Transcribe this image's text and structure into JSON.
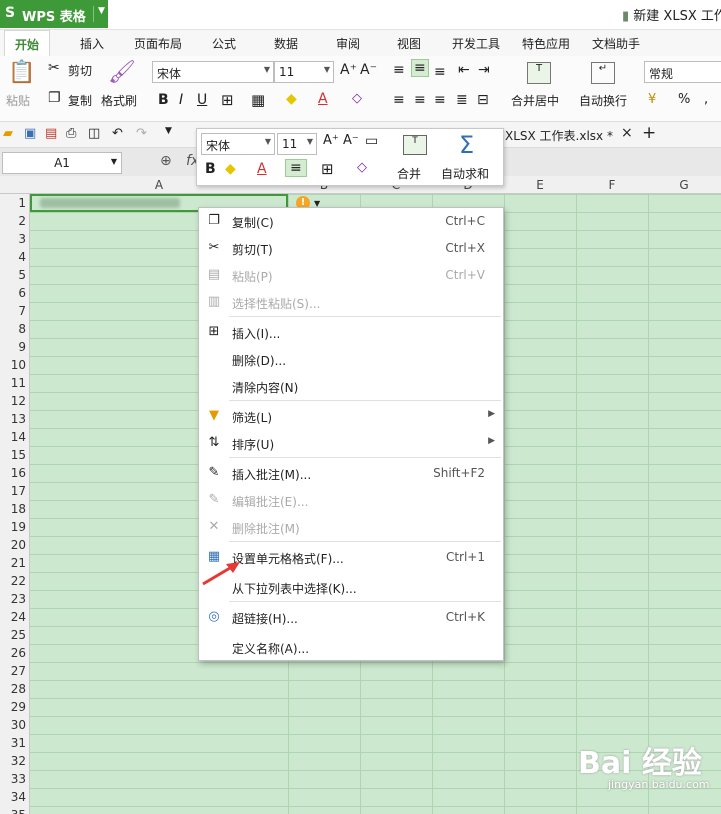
{
  "app": {
    "name": "WPS 表格",
    "logo": "S",
    "doc_title": "新建 XLSX 工作"
  },
  "tabs": [
    "开始",
    "插入",
    "页面布局",
    "公式",
    "数据",
    "审阅",
    "视图",
    "开发工具",
    "特色应用",
    "文档助手"
  ],
  "ribbon": {
    "paste": "粘贴",
    "cut": "剪切",
    "copy": "复制",
    "format_painter": "格式刷",
    "font_name": "宋体",
    "font_size": "11",
    "merge_center": "合并居中",
    "wrap_text": "自动换行",
    "number_format": "常规",
    "percent": "%"
  },
  "doc_tab": {
    "name": "XLSX 工作表.xlsx *",
    "close": "×",
    "new": "+"
  },
  "formula_bar": {
    "cell_ref": "A1",
    "fx": "fx"
  },
  "columns": [
    "A",
    "B",
    "C",
    "D",
    "E",
    "F",
    "G"
  ],
  "rows": [
    "1",
    "2",
    "3",
    "4",
    "5",
    "6",
    "7",
    "8",
    "9",
    "10",
    "11",
    "12",
    "13",
    "14",
    "15",
    "16",
    "17",
    "18",
    "19",
    "20",
    "21",
    "22",
    "23",
    "24",
    "25",
    "26",
    "27",
    "28",
    "29",
    "30",
    "31",
    "32",
    "33",
    "34",
    "35"
  ],
  "mini_toolbar": {
    "font_name": "宋体",
    "font_size": "11",
    "merge": "合并",
    "autosum": "自动求和"
  },
  "context_menu": [
    {
      "label": "复制(C)",
      "shortcut": "Ctrl+C",
      "icon": "copy-icon",
      "disabled": false
    },
    {
      "label": "剪切(T)",
      "shortcut": "Ctrl+X",
      "icon": "scissors-icon",
      "disabled": false
    },
    {
      "label": "粘贴(P)",
      "shortcut": "Ctrl+V",
      "icon": "paste-icon",
      "disabled": true
    },
    {
      "label": "选择性粘贴(S)...",
      "shortcut": "",
      "icon": "paste-special-icon",
      "disabled": true
    },
    {
      "label": "插入(I)...",
      "shortcut": "",
      "icon": "insert-icon",
      "disabled": false
    },
    {
      "label": "删除(D)...",
      "shortcut": "",
      "icon": "",
      "disabled": false
    },
    {
      "label": "清除内容(N)",
      "shortcut": "",
      "icon": "",
      "disabled": false
    },
    {
      "label": "筛选(L)",
      "shortcut": "",
      "icon": "filter-icon",
      "disabled": false,
      "submenu": true
    },
    {
      "label": "排序(U)",
      "shortcut": "",
      "icon": "sort-icon",
      "disabled": false,
      "submenu": true
    },
    {
      "label": "插入批注(M)...",
      "shortcut": "Shift+F2",
      "icon": "comment-add-icon",
      "disabled": false
    },
    {
      "label": "编辑批注(E)...",
      "shortcut": "",
      "icon": "comment-edit-icon",
      "disabled": true
    },
    {
      "label": "删除批注(M)",
      "shortcut": "",
      "icon": "comment-delete-icon",
      "disabled": true
    },
    {
      "label": "设置单元格格式(F)...",
      "shortcut": "Ctrl+1",
      "icon": "format-cells-icon",
      "disabled": false
    },
    {
      "label": "从下拉列表中选择(K)...",
      "shortcut": "",
      "icon": "",
      "disabled": false
    },
    {
      "label": "超链接(H)...",
      "shortcut": "Ctrl+K",
      "icon": "hyperlink-icon",
      "disabled": false
    },
    {
      "label": "定义名称(A)...",
      "shortcut": "",
      "icon": "",
      "disabled": false
    }
  ],
  "watermark": {
    "brand": "Bai 经验",
    "url": "jingyan.baidu.com"
  },
  "colors": {
    "accent": "#3e9a38",
    "grid": "#cce8cf",
    "arrow": "#e53935"
  }
}
